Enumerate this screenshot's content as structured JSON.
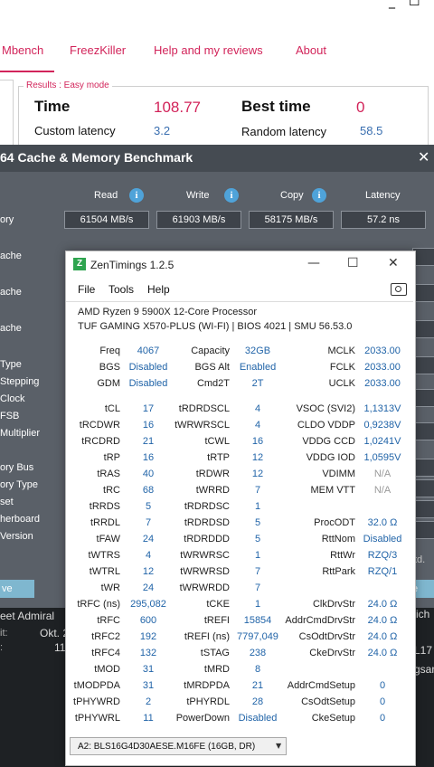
{
  "bg_window": {
    "controls": [
      "_",
      "☐"
    ],
    "tabs": [
      "Mbench",
      "FreezKiller",
      "Help and my reviews",
      "About"
    ],
    "results_title": "Results : Easy mode",
    "time_label": "Time",
    "time_value": "108.77",
    "best_label": "Best time",
    "best_value": "0",
    "custom_label": "Custom latency",
    "custom_value": "3.2",
    "random_label": "Random latency",
    "random_value": "58.5"
  },
  "aida": {
    "title": "64 Cache & Memory Benchmark",
    "close": "✕",
    "columns": [
      "Read",
      "Write",
      "Copy",
      "Latency"
    ],
    "memory_label": "ory",
    "memory_values": [
      "61504 MB/s",
      "61903 MB/s",
      "58175 MB/s",
      "57.2 ns"
    ],
    "side_labels": [
      "ache",
      "ache",
      "ache",
      "Type",
      "Stepping",
      "Clock",
      "FSB",
      "Multiplier",
      "ory Bus",
      "ory Type",
      "set",
      "herboard",
      "Version"
    ],
    "save_label": "ve",
    "save_label2": "e",
    "ltd": "td."
  },
  "bottom": {
    "a1": "eet Admiral",
    "a2": "it:",
    "a3": "Okt. 2",
    "a4": ":",
    "a5": "11",
    "r1": "ich",
    "r2": "L17",
    "r3": "gsar"
  },
  "zen": {
    "title": "ZenTimings 1.2.5",
    "logo": "Z",
    "controls": [
      "—",
      "☐",
      "✕"
    ],
    "menu": [
      "File",
      "Tools",
      "Help"
    ],
    "cpu": "AMD Ryzen 9 5900X 12-Core Processor",
    "board": "TUF GAMING X570-PLUS (WI-FI) | BIOS 4021 | SMU 56.53.0",
    "rows_top": [
      [
        "Freq",
        "4067",
        "Capacity",
        "32GB",
        "MCLK",
        "2033.00"
      ],
      [
        "BGS",
        "Disabled",
        "BGS Alt",
        "Enabled",
        "FCLK",
        "2033.00"
      ],
      [
        "GDM",
        "Disabled",
        "Cmd2T",
        "2T",
        "UCLK",
        "2033.00"
      ]
    ],
    "rows": [
      [
        "tCL",
        "17",
        "tRDRDSCL",
        "4",
        "VSOC (SVI2)",
        "1,1313V"
      ],
      [
        "tRCDWR",
        "16",
        "tWRWRSCL",
        "4",
        "CLDO VDDP",
        "0,9238V"
      ],
      [
        "tRCDRD",
        "21",
        "tCWL",
        "16",
        "VDDG CCD",
        "1,0241V"
      ],
      [
        "tRP",
        "16",
        "tRTP",
        "12",
        "VDDG IOD",
        "1,0595V"
      ],
      [
        "tRAS",
        "40",
        "tRDWR",
        "12",
        "VDIMM",
        "N/A"
      ],
      [
        "tRC",
        "68",
        "tWRRD",
        "7",
        "MEM VTT",
        "N/A"
      ],
      [
        "tRRDS",
        "5",
        "tRDRDSC",
        "1",
        "",
        ""
      ],
      [
        "tRRDL",
        "7",
        "tRDRDSD",
        "5",
        "ProcODT",
        "32.0 Ω"
      ],
      [
        "tFAW",
        "24",
        "tRDRDDD",
        "5",
        "RttNom",
        "Disabled"
      ],
      [
        "tWTRS",
        "4",
        "tWRWRSC",
        "1",
        "RttWr",
        "RZQ/3"
      ],
      [
        "tWTRL",
        "12",
        "tWRWRSD",
        "7",
        "RttPark",
        "RZQ/1"
      ],
      [
        "tWR",
        "24",
        "tWRWRDD",
        "7",
        "",
        ""
      ],
      [
        "tRFC (ns)",
        "295,082",
        "tCKE",
        "1",
        "ClkDrvStr",
        "24.0 Ω"
      ],
      [
        "tRFC",
        "600",
        "tREFI",
        "15854",
        "AddrCmdDrvStr",
        "24.0 Ω"
      ],
      [
        "tRFC2",
        "192",
        "tREFI (ns)",
        "7797,049",
        "CsOdtDrvStr",
        "24.0 Ω"
      ],
      [
        "tRFC4",
        "132",
        "tSTAG",
        "238",
        "CkeDrvStr",
        "24.0 Ω"
      ],
      [
        "tMOD",
        "31",
        "tMRD",
        "8",
        "",
        ""
      ],
      [
        "tMODPDA",
        "31",
        "tMRDPDA",
        "21",
        "AddrCmdSetup",
        "0"
      ],
      [
        "tPHYWRD",
        "2",
        "tPHYRDL",
        "28",
        "CsOdtSetup",
        "0"
      ],
      [
        "tPHYWRL",
        "11",
        "PowerDown",
        "Disabled",
        "CkeSetup",
        "0"
      ]
    ],
    "dimm_select": "A2: BLS16G4D30AESE.M16FE (16GB, DR)"
  }
}
